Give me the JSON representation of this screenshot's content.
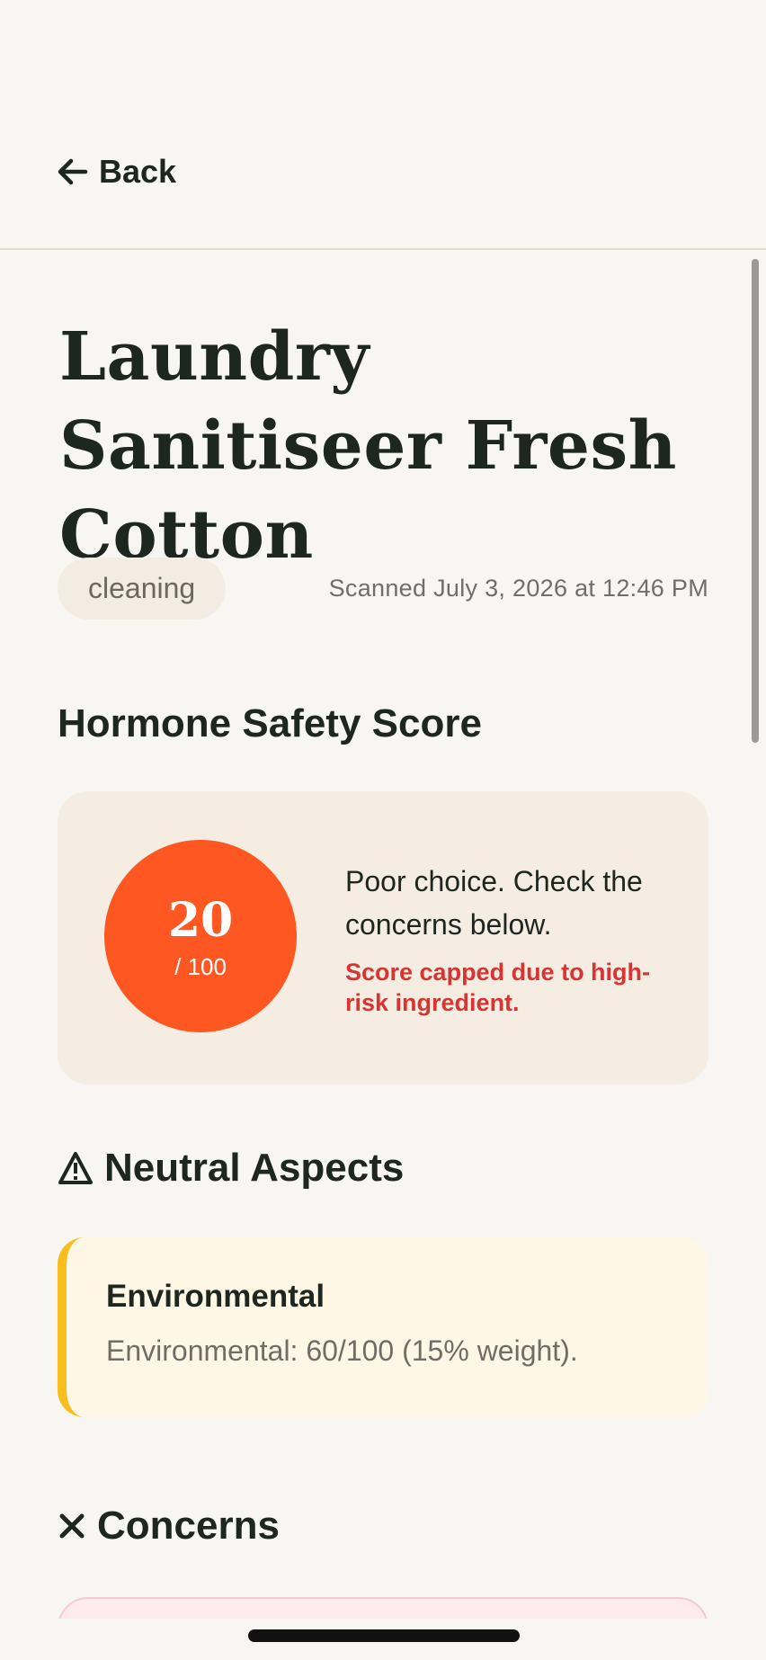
{
  "header": {
    "back_label": "Back",
    "back_icon": "arrow-left-icon"
  },
  "product": {
    "title": "Laundry Sanitiseer Fresh Cotton",
    "category": "cleaning",
    "scanned": "Scanned July 3, 2026 at 12:46 PM"
  },
  "score_section": {
    "heading": "Hormone Safety Score",
    "score": "20",
    "max": "/ 100",
    "message": "Poor choice. Check the concerns below.",
    "warning": "Score capped due to high-risk ingredient.",
    "score_color": "#FF5722",
    "warning_color": "#D83434"
  },
  "neutral_section": {
    "heading": "Neutral Aspects",
    "icon": "warning-triangle-icon",
    "items": [
      {
        "title": "Environmental",
        "description": "Environmental: 60/100 (15% weight).",
        "accent": "#F7BE1E"
      }
    ]
  },
  "concerns_section": {
    "heading": "Concerns",
    "icon": "x-icon"
  }
}
